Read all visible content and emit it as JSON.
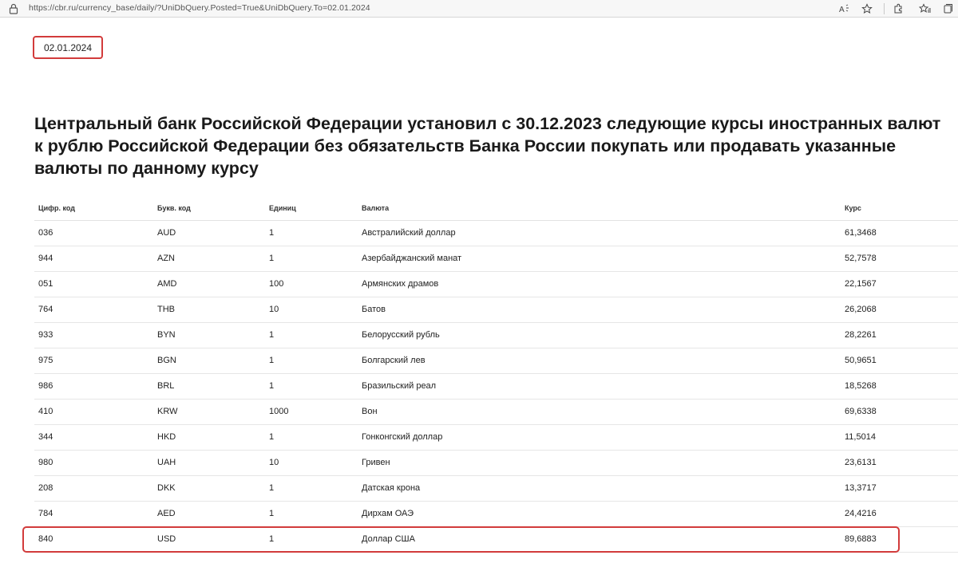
{
  "browser": {
    "url": "https://cbr.ru/currency_base/daily/?UniDbQuery.Posted=True&UniDbQuery.To=02.01.2024"
  },
  "date_field": {
    "value": "02.01.2024"
  },
  "heading": "Центральный банк Российской Федерации установил с 30.12.2023 следующие курсы иностранных валют к рублю Российской Федерации без обязательств Банка России покупать или продавать указанные валюты по данному курсу",
  "table": {
    "headers": [
      "Цифр. код",
      "Букв. код",
      "Единиц",
      "Валюта",
      "Курс"
    ],
    "rows": [
      [
        "036",
        "AUD",
        "1",
        "Австралийский доллар",
        "61,3468"
      ],
      [
        "944",
        "AZN",
        "1",
        "Азербайджанский манат",
        "52,7578"
      ],
      [
        "051",
        "AMD",
        "100",
        "Армянских драмов",
        "22,1567"
      ],
      [
        "764",
        "THB",
        "10",
        "Батов",
        "26,2068"
      ],
      [
        "933",
        "BYN",
        "1",
        "Белорусский рубль",
        "28,2261"
      ],
      [
        "975",
        "BGN",
        "1",
        "Болгарский лев",
        "50,9651"
      ],
      [
        "986",
        "BRL",
        "1",
        "Бразильский реал",
        "18,5268"
      ],
      [
        "410",
        "KRW",
        "1000",
        "Вон",
        "69,6338"
      ],
      [
        "344",
        "HKD",
        "1",
        "Гонконгский доллар",
        "11,5014"
      ],
      [
        "980",
        "UAH",
        "10",
        "Гривен",
        "23,6131"
      ],
      [
        "208",
        "DKK",
        "1",
        "Датская крона",
        "13,3717"
      ],
      [
        "784",
        "AED",
        "1",
        "Дирхам ОАЭ",
        "24,4216"
      ],
      [
        "840",
        "USD",
        "1",
        "Доллар США",
        "89,6883"
      ]
    ],
    "highlighted_row_code": "840"
  },
  "colors": {
    "highlight": "#d23b3b",
    "row_border": "#e6e6e6"
  },
  "icons": [
    "lock-icon",
    "read-aloud-icon",
    "favorite-star-icon",
    "extensions-icon",
    "favorites-icon",
    "collections-icon"
  ]
}
